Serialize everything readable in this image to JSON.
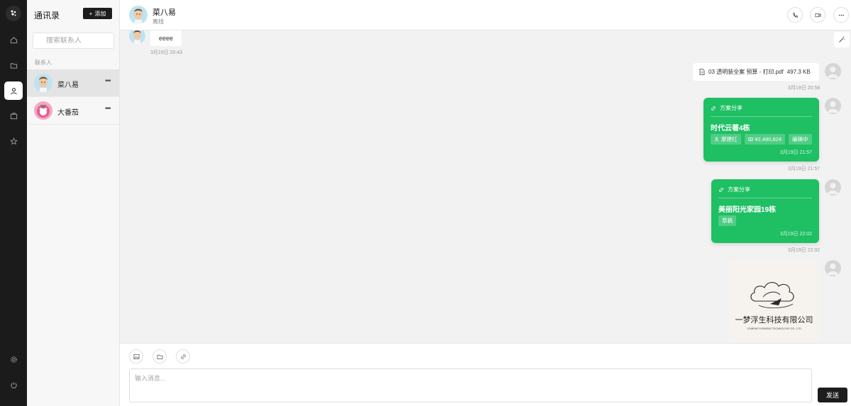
{
  "contacts_panel": {
    "title": "通讯录",
    "add_label": "添加",
    "search_placeholder": "搜索联系人",
    "section_label": "联系人",
    "items": [
      {
        "name": "菜八易",
        "active": true
      },
      {
        "name": "大番茄",
        "active": false
      }
    ]
  },
  "header": {
    "name": "菜八易",
    "status": "离线"
  },
  "messages": {
    "incoming_text": "eeee",
    "incoming_time": "3月19日 20:43",
    "file_name": "03 透明装全案 预算 - 打印.pdf",
    "file_size": "497.3 KB",
    "file_time": "3月19日 20:58",
    "card1": {
      "header": "方案分享",
      "title": "时代云著4栋",
      "person": "廖建红",
      "amount": "¥2,480,824",
      "status": "编辑中",
      "inner_time": "3月19日 21:57",
      "outer_time": "3月19日 21:57"
    },
    "card2": {
      "header": "方案分享",
      "title": "美丽阳光家园19栋",
      "status": "草稿",
      "inner_time": "3月19日 22:02",
      "outer_time": "3月19日 22:02"
    },
    "image_logo": {
      "cn": "一梦浮生科技有限公司",
      "en": "YOMENG FUSHENG TECHNOLOGY CO., LTD"
    }
  },
  "composer": {
    "placeholder": "输入消息...",
    "send_label": "发送"
  },
  "colors": {
    "accent_green": "#1fbf63",
    "dark": "#1d1d1d",
    "rail": "#1b1b1b"
  }
}
